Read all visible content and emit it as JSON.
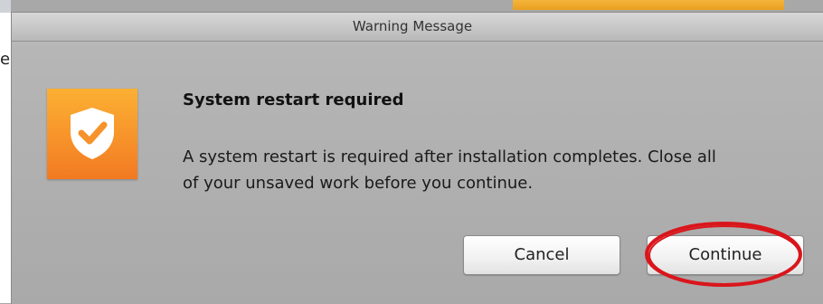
{
  "dialog": {
    "title": "Warning Message",
    "heading": "System restart required",
    "message_line1": "A system restart is required after installation completes. Close all",
    "message_line2": "of your unsaved work before you continue.",
    "icon": "shield-check-icon",
    "icon_color": "#f7932a",
    "buttons": {
      "cancel_label": "Cancel",
      "continue_label": "Continue"
    },
    "annotation_color": "#d9161c"
  },
  "background": {
    "partial_glyph": "e",
    "accent_color": "#f0a82e"
  }
}
